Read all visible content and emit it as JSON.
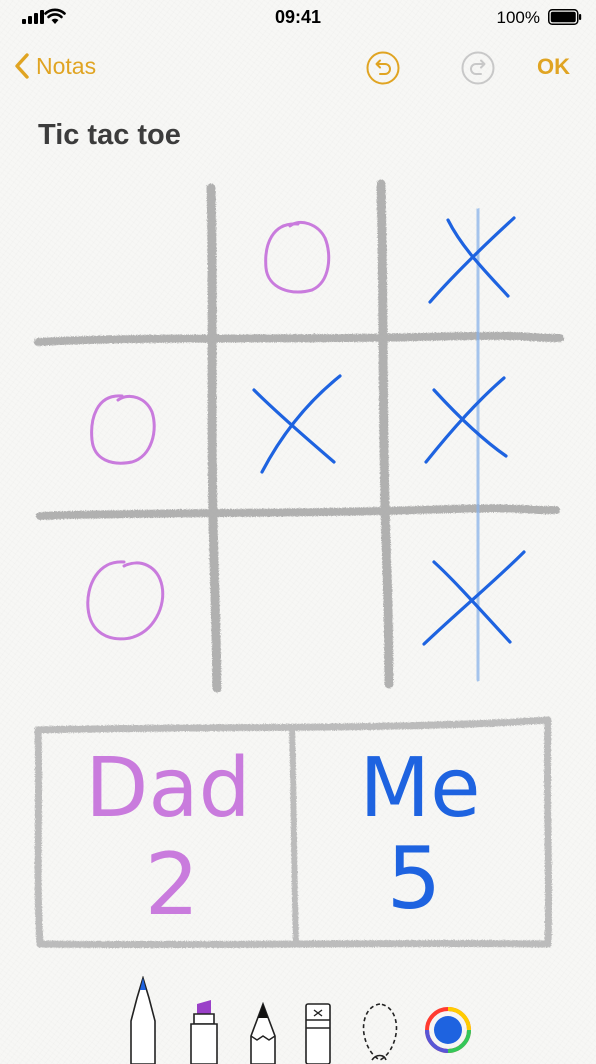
{
  "status": {
    "time": "09:41",
    "battery": "100%"
  },
  "nav": {
    "back_label": "Notas",
    "done_label": "OK"
  },
  "note": {
    "title": "Tic tac toe"
  },
  "board": {
    "rows": [
      [
        "",
        "O",
        "X"
      ],
      [
        "O",
        "X",
        "X"
      ],
      [
        "O",
        "",
        "X"
      ]
    ],
    "winning_line": "right-column"
  },
  "score": {
    "player1": {
      "name": "Dad",
      "score": "2",
      "color": "#c97bdd"
    },
    "player2": {
      "name": "Me",
      "score": "5",
      "color": "#1e63e0"
    }
  },
  "tools": {
    "items": [
      "pen",
      "marker",
      "pencil",
      "eraser",
      "lasso",
      "color-picker"
    ],
    "selected_color": "#1e63e0"
  }
}
